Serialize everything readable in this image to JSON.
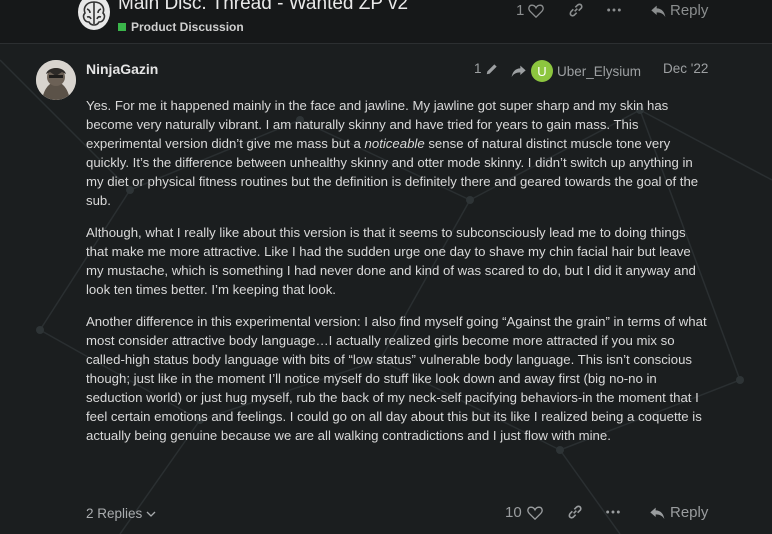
{
  "topic": {
    "title": "Main Disc. Thread - Wanted ZP v2",
    "category": "Product Discussion",
    "category_color": "#3ab54a"
  },
  "header_actions": {
    "like_count": "1",
    "reply_label": "Reply"
  },
  "post": {
    "username": "NinjaGazin",
    "edit_count": "1",
    "reply_to_initial": "U",
    "reply_to_user": "Uber_Elysium",
    "reply_to_avatar_color": "#8dc63f",
    "date": "Dec '22",
    "p1_before": "Yes. For me it happened mainly in the face and jawline. My jawline got super sharp and my skin has become very naturally vibrant. I am naturally skinny and have tried for years to gain mass. This experimental version didn’t give me mass but a ",
    "p1_em": "noticeable",
    "p1_after": " sense of natural distinct muscle tone very quickly. It’s the difference between unhealthy skinny and otter mode skinny. I didn’t switch up anything in my diet or physical fitness routines but the definition is definitely there and geared towards the goal of the sub.",
    "p2": "Although, what I really like about this version is that it seems to subconsciously lead me to doing things that make me more attractive. Like I had the sudden urge one day to shave my chin facial hair but leave my mustache, which is something I had never done and kind of was scared to do, but I did it anyway and look ten times better. I’m keeping that look.",
    "p3": "Another difference in this experimental version: I also find myself going “Against the grain” in terms of what most consider attractive body language…I actually realized girls become more attracted if you mix so called-high status body language with bits of “low status” vulnerable body language. This isn’t conscious though; just like in the moment I’ll notice myself do stuff like look down and away first (big no-no in seduction world) or just hug myself, rub the back of my neck-self pacifying behaviors-in the moment that I feel certain emotions and feelings. I could go on all day about this but its like I realized being a coquette is actually being genuine because we are all walking contradictions and I just flow with mine.",
    "replies_label": "2 Replies",
    "like_count": "10",
    "reply_label": "Reply"
  }
}
